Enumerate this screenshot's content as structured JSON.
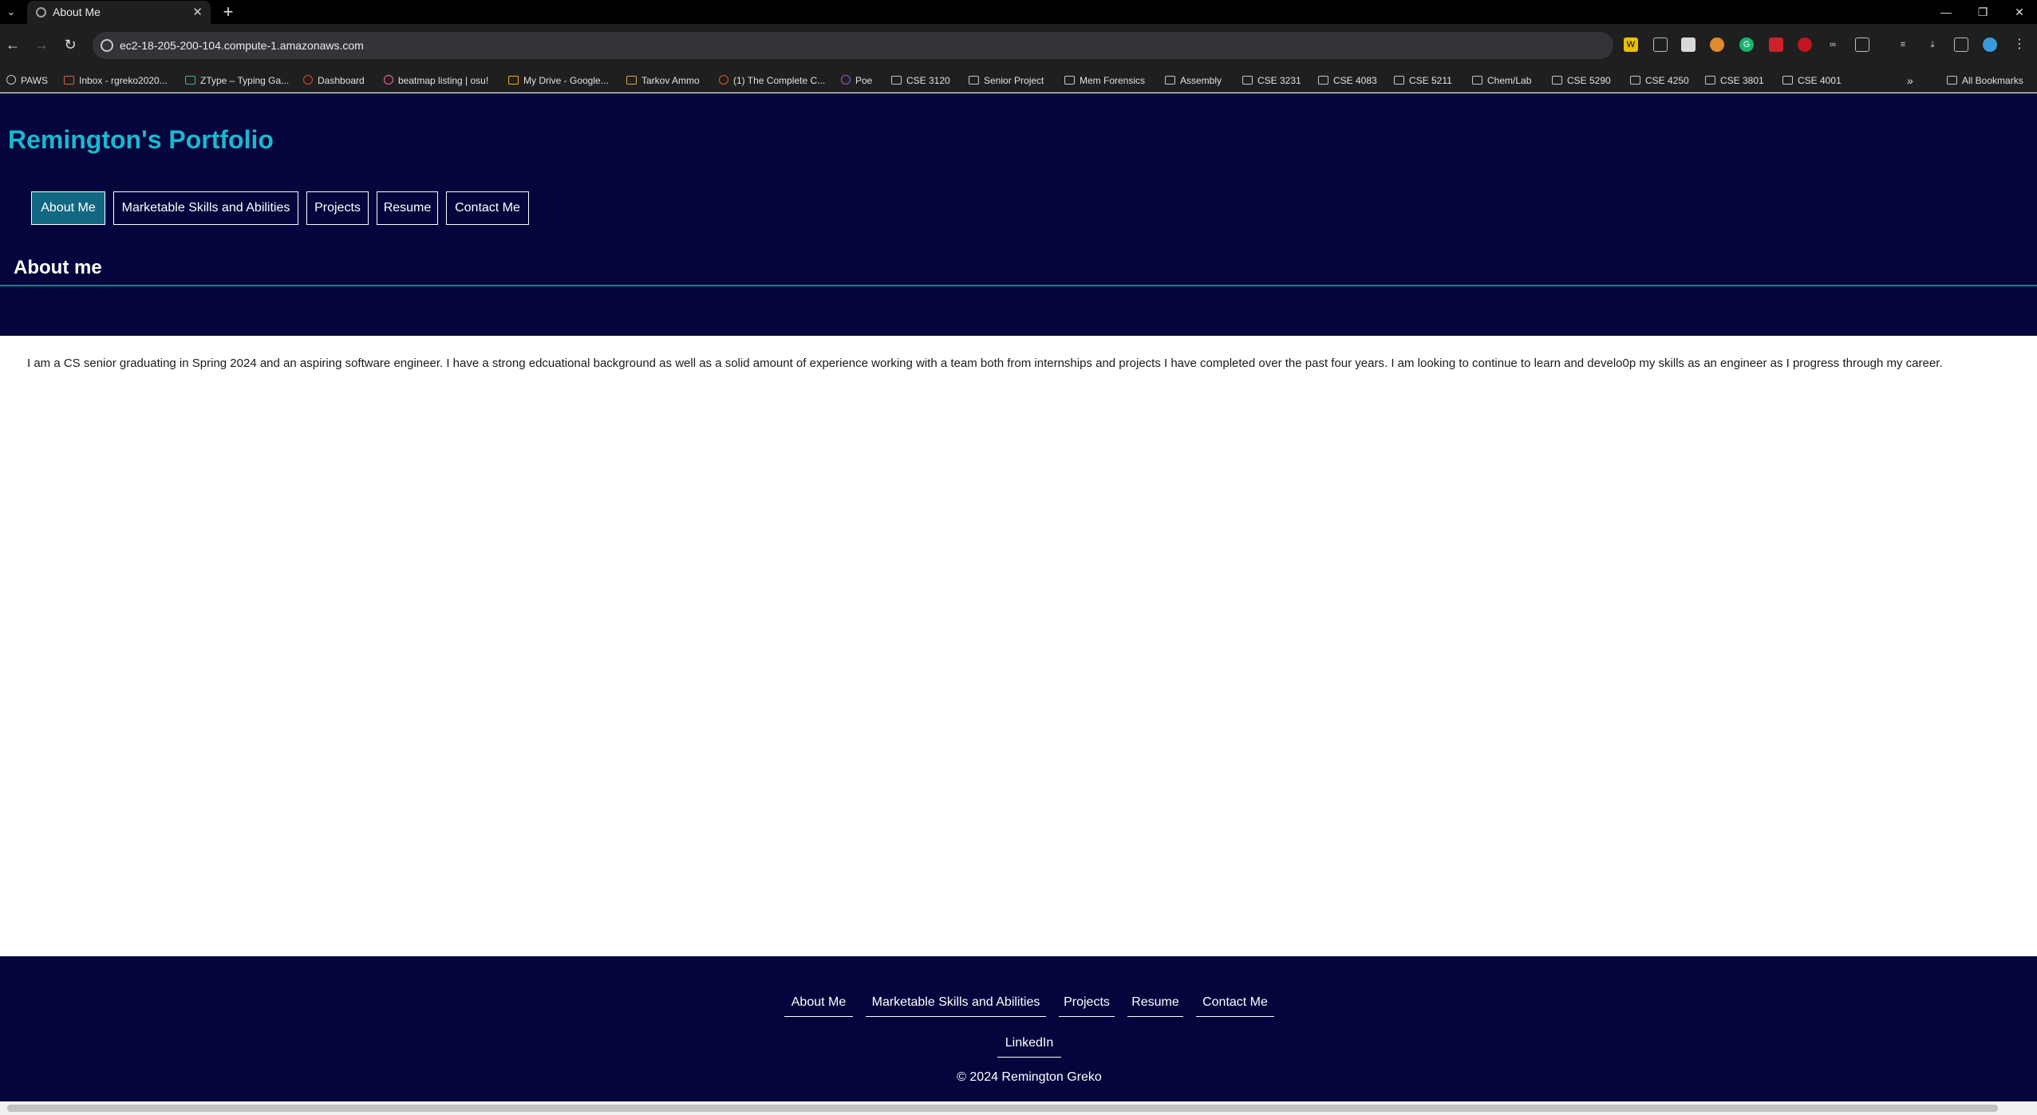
{
  "browser": {
    "tab_title": "About Me",
    "url": "ec2-18-205-200-104.compute-1.amazonaws.com",
    "bookmarks": [
      "PAWS",
      "Inbox - rgreko2020...",
      "ZType – Typing Ga...",
      "Dashboard",
      "beatmap listing | osu!",
      "My Drive - Google...",
      "Tarkov Ammo",
      "(1) The Complete C...",
      "Poe",
      "CSE 3120",
      "Senior Project",
      "Mem Forensics",
      "Assembly",
      "CSE 3231",
      "CSE 4083",
      "CSE 5211",
      "Chem/Lab",
      "CSE 5290",
      "CSE 4250",
      "CSE 3801",
      "CSE 4001"
    ],
    "all_bookmarks": "All Bookmarks"
  },
  "site": {
    "title": "Remington's Portfolio",
    "nav": [
      "About Me",
      "Marketable Skills and Abilities",
      "Projects",
      "Resume",
      "Contact Me"
    ],
    "heading": "About me",
    "about": "I am a CS senior graduating in Spring 2024 and an aspiring software engineer. I have a strong edcuational background as well as a solid amount of experience working with a team both from internships and projects I have completed over the past four years. I am looking to continue to learn and develo0p my skills as an engineer as I progress through my career.",
    "footer_nav": [
      "About Me",
      "Marketable Skills and Abilities",
      "Projects",
      "Resume",
      "Contact Me"
    ],
    "footer_linkedin": "LinkedIn",
    "copyright": "© 2024 Remington Greko"
  },
  "colors": {
    "header_bg": "#04053c",
    "title": "#18b9cf",
    "active_nav": "#126882"
  }
}
